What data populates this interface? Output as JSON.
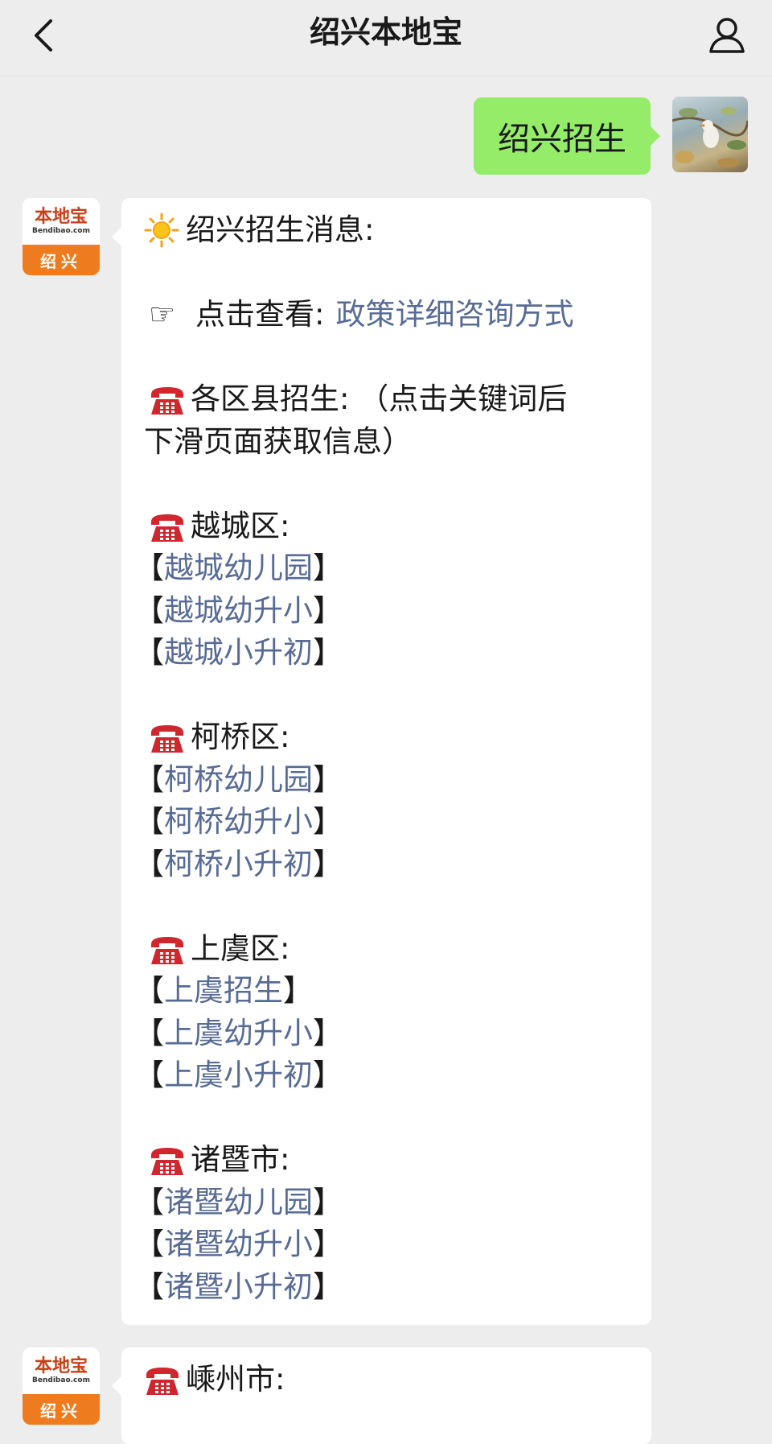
{
  "header": {
    "title": "绍兴本地宝"
  },
  "outgoing": {
    "text": "绍兴招生"
  },
  "bot_avatar": {
    "logo_main": "本地宝",
    "logo_sub": "Bendibao.com",
    "city": "绍兴"
  },
  "message1": {
    "heading": "绍兴招生消息:",
    "view_label": "点击查看:",
    "view_link": "政策详细咨询方式",
    "district_intro_1": "各区县招生: （点击关键词后",
    "district_intro_2": "下滑页面获取信息）",
    "districts": [
      {
        "name": "越城区:",
        "links": [
          "越城幼儿园",
          "越城幼升小",
          "越城小升初"
        ]
      },
      {
        "name": "柯桥区:",
        "links": [
          "柯桥幼儿园",
          "柯桥幼升小",
          "柯桥小升初"
        ]
      },
      {
        "name": "上虞区:",
        "links": [
          "上虞招生",
          "上虞幼升小",
          "上虞小升初"
        ]
      },
      {
        "name": "诸暨市:",
        "links": [
          "诸暨幼儿园",
          "诸暨幼升小",
          "诸暨小升初"
        ]
      }
    ]
  },
  "message2": {
    "district": "嵊州市:"
  },
  "colors": {
    "link": "#576b95",
    "outgoing_bubble": "#95ec69",
    "background": "#ededed",
    "brand_orange": "#ee7b1e"
  }
}
